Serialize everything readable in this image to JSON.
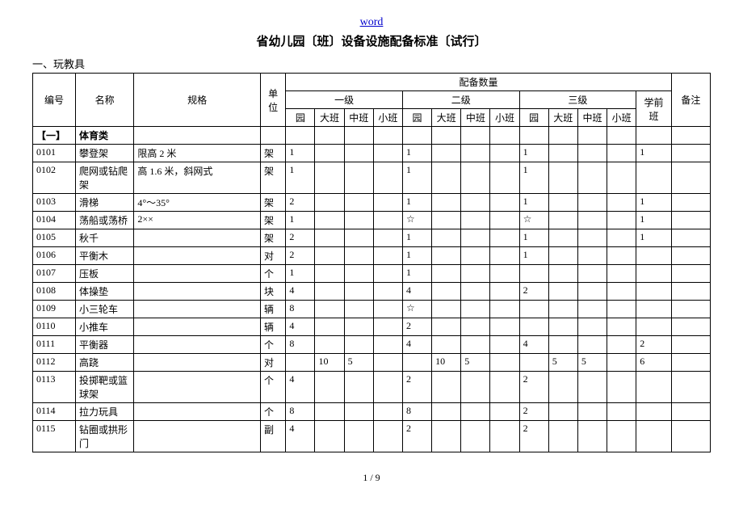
{
  "header_link": "word",
  "title": "省幼儿园〔班〕设备设施配备标准〔试行〕",
  "section_caption": "一、玩教具",
  "page_footer": "1 / 9",
  "tableHeaders": {
    "num": "编号",
    "name": "名称",
    "spec": "规格",
    "unit": "单位",
    "qty_group": "配备数量",
    "level1": "一级",
    "level2": "二级",
    "level3": "三级",
    "preschool": "学前班",
    "remark": "备注",
    "yuan": "园",
    "da": "大班",
    "zhong": "中班",
    "xiao": "小班"
  },
  "sectionRow": {
    "num": "【一】",
    "name": "体育类"
  },
  "rows": [
    {
      "num": "0101",
      "name": "攀登架",
      "spec": "限高 2 米",
      "unit": "架",
      "l1": [
        "1",
        "",
        "",
        ""
      ],
      "l2": [
        "1",
        "",
        "",
        ""
      ],
      "l3": [
        "1",
        "",
        "",
        ""
      ],
      "pre": "1",
      "rem": ""
    },
    {
      "num": "0102",
      "name": "爬网或钻爬架",
      "spec": "高 1.6 米，斜网式",
      "unit": "架",
      "l1": [
        "1",
        "",
        "",
        ""
      ],
      "l2": [
        "1",
        "",
        "",
        ""
      ],
      "l3": [
        "1",
        "",
        "",
        ""
      ],
      "pre": "",
      "rem": ""
    },
    {
      "num": "0103",
      "name": "滑梯",
      "spec": "4°～35°",
      "unit": "架",
      "l1": [
        "2",
        "",
        "",
        ""
      ],
      "l2": [
        "1",
        "",
        "",
        ""
      ],
      "l3": [
        "1",
        "",
        "",
        ""
      ],
      "pre": "1",
      "rem": ""
    },
    {
      "num": "0104",
      "name": "荡船或荡桥",
      "spec": "2××",
      "unit": "架",
      "l1": [
        "1",
        "",
        "",
        ""
      ],
      "l2": [
        "☆",
        "",
        "",
        ""
      ],
      "l3": [
        "☆",
        "",
        "",
        ""
      ],
      "pre": "1",
      "rem": ""
    },
    {
      "num": "0105",
      "name": "秋千",
      "spec": "",
      "unit": "架",
      "l1": [
        "2",
        "",
        "",
        ""
      ],
      "l2": [
        "1",
        "",
        "",
        ""
      ],
      "l3": [
        "1",
        "",
        "",
        ""
      ],
      "pre": "1",
      "rem": ""
    },
    {
      "num": "0106",
      "name": "平衡木",
      "spec": "",
      "unit": "对",
      "l1": [
        "2",
        "",
        "",
        ""
      ],
      "l2": [
        "1",
        "",
        "",
        ""
      ],
      "l3": [
        "1",
        "",
        "",
        ""
      ],
      "pre": "",
      "rem": ""
    },
    {
      "num": "0107",
      "name": "压板",
      "spec": "",
      "unit": "个",
      "l1": [
        "1",
        "",
        "",
        ""
      ],
      "l2": [
        "1",
        "",
        "",
        ""
      ],
      "l3": [
        "",
        "",
        "",
        ""
      ],
      "pre": "",
      "rem": ""
    },
    {
      "num": "0108",
      "name": "体操垫",
      "spec": "",
      "unit": "块",
      "l1": [
        "4",
        "",
        "",
        ""
      ],
      "l2": [
        "4",
        "",
        "",
        ""
      ],
      "l3": [
        "2",
        "",
        "",
        ""
      ],
      "pre": "",
      "rem": ""
    },
    {
      "num": "0109",
      "name": "小三轮车",
      "spec": "",
      "unit": "辆",
      "l1": [
        "8",
        "",
        "",
        ""
      ],
      "l2": [
        "☆",
        "",
        "",
        ""
      ],
      "l3": [
        "",
        "",
        "",
        ""
      ],
      "pre": "",
      "rem": ""
    },
    {
      "num": "0110",
      "name": "小推车",
      "spec": "",
      "unit": "辆",
      "l1": [
        "4",
        "",
        "",
        ""
      ],
      "l2": [
        "2",
        "",
        "",
        ""
      ],
      "l3": [
        "",
        "",
        "",
        ""
      ],
      "pre": "",
      "rem": ""
    },
    {
      "num": "0111",
      "name": "平衡器",
      "spec": "",
      "unit": "个",
      "l1": [
        "8",
        "",
        "",
        ""
      ],
      "l2": [
        "4",
        "",
        "",
        ""
      ],
      "l3": [
        "4",
        "",
        "",
        ""
      ],
      "pre": "2",
      "rem": ""
    },
    {
      "num": "0112",
      "name": "高跷",
      "spec": "",
      "unit": "对",
      "l1": [
        "",
        "10",
        "5",
        ""
      ],
      "l2": [
        "",
        "10",
        "5",
        ""
      ],
      "l3": [
        "",
        "5",
        "5",
        ""
      ],
      "pre": "6",
      "rem": ""
    },
    {
      "num": "0113",
      "name": "投掷靶或篮球架",
      "spec": "",
      "unit": "个",
      "l1": [
        "4",
        "",
        "",
        ""
      ],
      "l2": [
        "2",
        "",
        "",
        ""
      ],
      "l3": [
        "2",
        "",
        "",
        ""
      ],
      "pre": "",
      "rem": ""
    },
    {
      "num": "0114",
      "name": "拉力玩具",
      "spec": "",
      "unit": "个",
      "l1": [
        "8",
        "",
        "",
        ""
      ],
      "l2": [
        "8",
        "",
        "",
        ""
      ],
      "l3": [
        "2",
        "",
        "",
        ""
      ],
      "pre": "",
      "rem": ""
    },
    {
      "num": "0115",
      "name": "钻圈或拱形门",
      "spec": "",
      "unit": "副",
      "l1": [
        "4",
        "",
        "",
        ""
      ],
      "l2": [
        "2",
        "",
        "",
        ""
      ],
      "l3": [
        "2",
        "",
        "",
        ""
      ],
      "pre": "",
      "rem": ""
    }
  ]
}
